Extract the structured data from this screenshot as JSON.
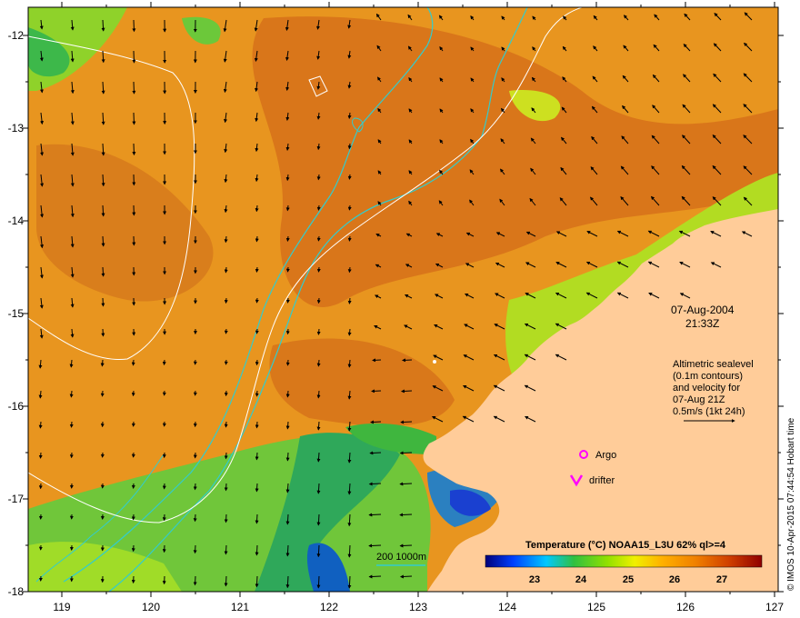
{
  "map": {
    "y_ticks": [
      "-12",
      "-13",
      "-14",
      "-15",
      "-16",
      "-17",
      "-18"
    ],
    "x_ticks": [
      "119",
      "120",
      "121",
      "122",
      "123",
      "124",
      "125",
      "126",
      "127"
    ],
    "lat_range": [
      -18,
      -11.9
    ],
    "lon_range": [
      118.6,
      127
    ]
  },
  "info": {
    "date": "07-Aug-2004",
    "time": "21:33Z",
    "note_lines": [
      "Altimetric sealevel",
      "(0.1m contours)",
      "and velocity for",
      "07-Aug 21Z",
      "0.5m/s (1kt 24h)"
    ]
  },
  "legend": {
    "argo_label": "Argo",
    "drifter_label": "drifter",
    "drifter_symbol": "V",
    "bathy_label": "200  1000m",
    "marker_color": "#ff00ff",
    "bathy_color": "#33cccc"
  },
  "colorbar": {
    "title": "Temperature (°C) NOAA15_L3U 62% ql>=4",
    "ticks": [
      "23",
      "24",
      "25",
      "26",
      "27"
    ]
  },
  "credit": "© IMOS 10-Apr-2015 07:44:54 Hobart time",
  "colors": {
    "land": "#ffcc99",
    "sst_warm": "#e08a1e",
    "sst_cool": "#2fb04a"
  }
}
